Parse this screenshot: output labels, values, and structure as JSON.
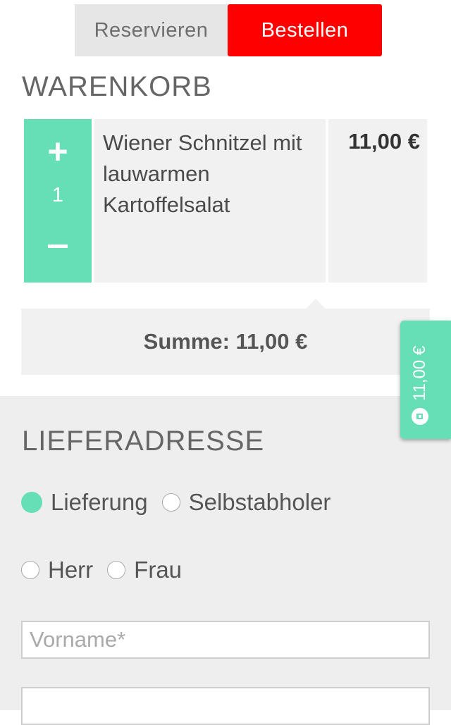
{
  "tabs": {
    "reservieren": "Reservieren",
    "bestellen": "Bestellen"
  },
  "cart": {
    "heading": "WARENKORB",
    "items": [
      {
        "name": "Wiener Schnitzel mit lauwarmen Kartoffelsalat",
        "quantity": "1",
        "plus_label": "+",
        "price": "11,00 €"
      }
    ],
    "sum_text": "Summe: 11,00 €"
  },
  "floating_cart": {
    "total": "11,00 €",
    "icon": "shopping-bag-icon"
  },
  "address": {
    "heading": "LIEFERADRESSE",
    "delivery_options": [
      "Lieferung",
      "Selbstabholer"
    ],
    "delivery_selected": "Lieferung",
    "salutation_options": [
      "Herr",
      "Frau"
    ],
    "first_name_placeholder": "Vorname*",
    "first_name_value": ""
  },
  "colors": {
    "accent": "#66dfb6",
    "brand_red": "#ff0000",
    "panel": "#f1f1f1"
  }
}
